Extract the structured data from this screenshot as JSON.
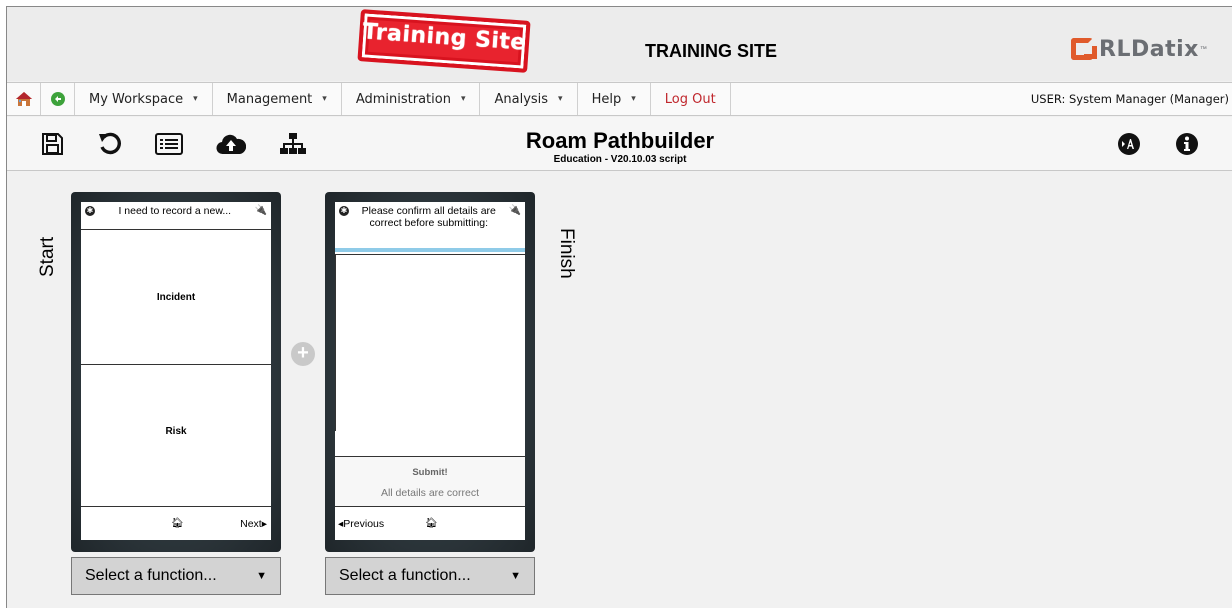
{
  "banner": {
    "stamp_text": "Training Site",
    "site_title": "TRAINING SITE",
    "logo_text": "RLDatix",
    "logo_tm": "™",
    "accent_color": "#e05a2b",
    "stamp_color": "#d8131f"
  },
  "menubar": {
    "icons": [
      "home-icon",
      "refresh-icon"
    ],
    "items": [
      {
        "label": "My Workspace",
        "caret": "▾"
      },
      {
        "label": "Management",
        "caret": "▾"
      },
      {
        "label": "Administration",
        "caret": "▾"
      },
      {
        "label": "Analysis",
        "caret": "▾"
      },
      {
        "label": "Help",
        "caret": "▾"
      }
    ],
    "logout_label": "Log Out",
    "logout_color": "#c0272d",
    "user_text": "USER: System Manager (Manager)"
  },
  "toolbar": {
    "icons": [
      "save-icon",
      "undo-icon",
      "list-icon",
      "cloud-upload-icon",
      "sitemap-icon",
      "accessibility-icon",
      "info-icon"
    ],
    "title": "Roam Pathbuilder",
    "subtitle": "Education - V20.10.03 script"
  },
  "canvas": {
    "start_label": "Start",
    "finish_label": "Finish",
    "screens": [
      {
        "question": "I need to record a new...",
        "choices": [
          "Incident",
          "Risk"
        ],
        "next_label": "Next",
        "select_value": "Select a function..."
      },
      {
        "question": "Please confirm all details are correct before submitting:",
        "submit_label": "Submit!",
        "confirm_text": "All details are correct",
        "prev_label": "Previous",
        "select_value": "Select a function..."
      }
    ]
  }
}
